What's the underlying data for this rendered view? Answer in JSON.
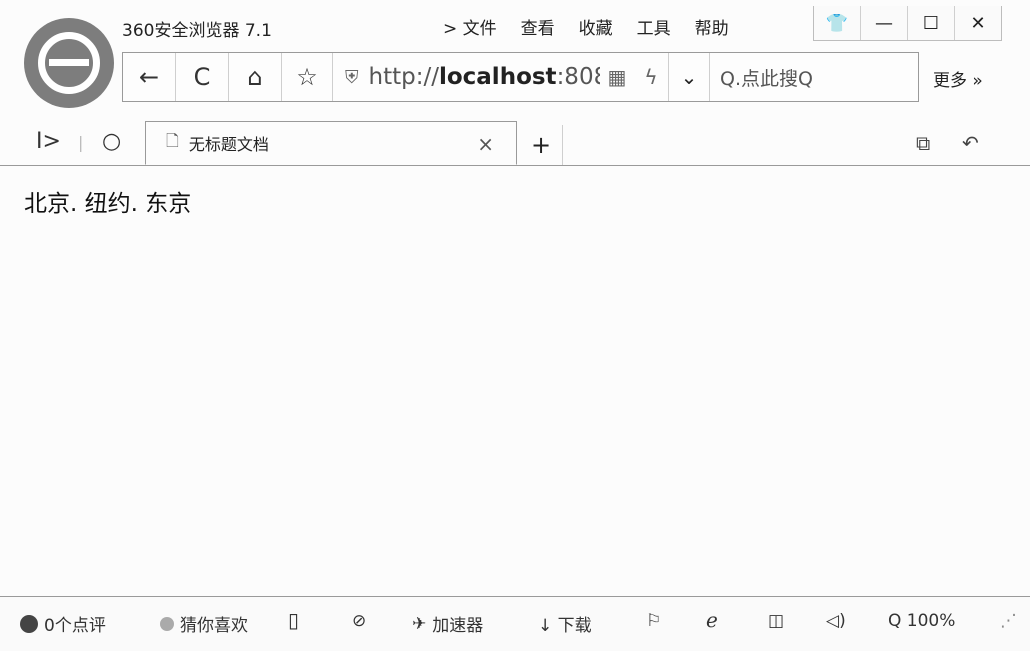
{
  "window": {
    "app_title": "360安全浏览器 7.1",
    "menu": [
      "> 文件",
      "查看",
      "收藏",
      "工具",
      "帮助"
    ],
    "controls": [
      "👕",
      "—",
      "☐",
      "✕"
    ]
  },
  "nav": {
    "back_icon": "←",
    "refresh_icon": "C",
    "home_icon": "⌂",
    "star_icon": "☆",
    "shield_icon": "⛨",
    "url_prefix": "http://",
    "url_host": "localhost",
    "url_suffix": ":808",
    "qr_icon": "▦",
    "bolt_icon": "ϟ",
    "dropdown_icon": "⌄",
    "search_text": "Q.点此搜Q",
    "more_label": "更多 »"
  },
  "tabs": {
    "left_icons": [
      "I>",
      "|",
      "○"
    ],
    "active": {
      "doc_icon": "🗋",
      "label": "无标题文档",
      "close_icon": "×"
    },
    "new_tab_icon": "+",
    "right_icons": [
      "⧉",
      "↶"
    ]
  },
  "page": {
    "content": "北京. 纽约. 东京"
  },
  "status": {
    "reviews": "0个点评",
    "guess": "猜你喜欢",
    "phone_icon": "▯",
    "speed_icon": "⊘",
    "accelerator": "加速器",
    "download": "↓ 下载",
    "flag_icon": "⚐",
    "ie_icon": "ℯ",
    "window_icon": "◫",
    "sound_icon": "◁)",
    "zoom": "Q 100%",
    "resize_icon": "⋰"
  }
}
